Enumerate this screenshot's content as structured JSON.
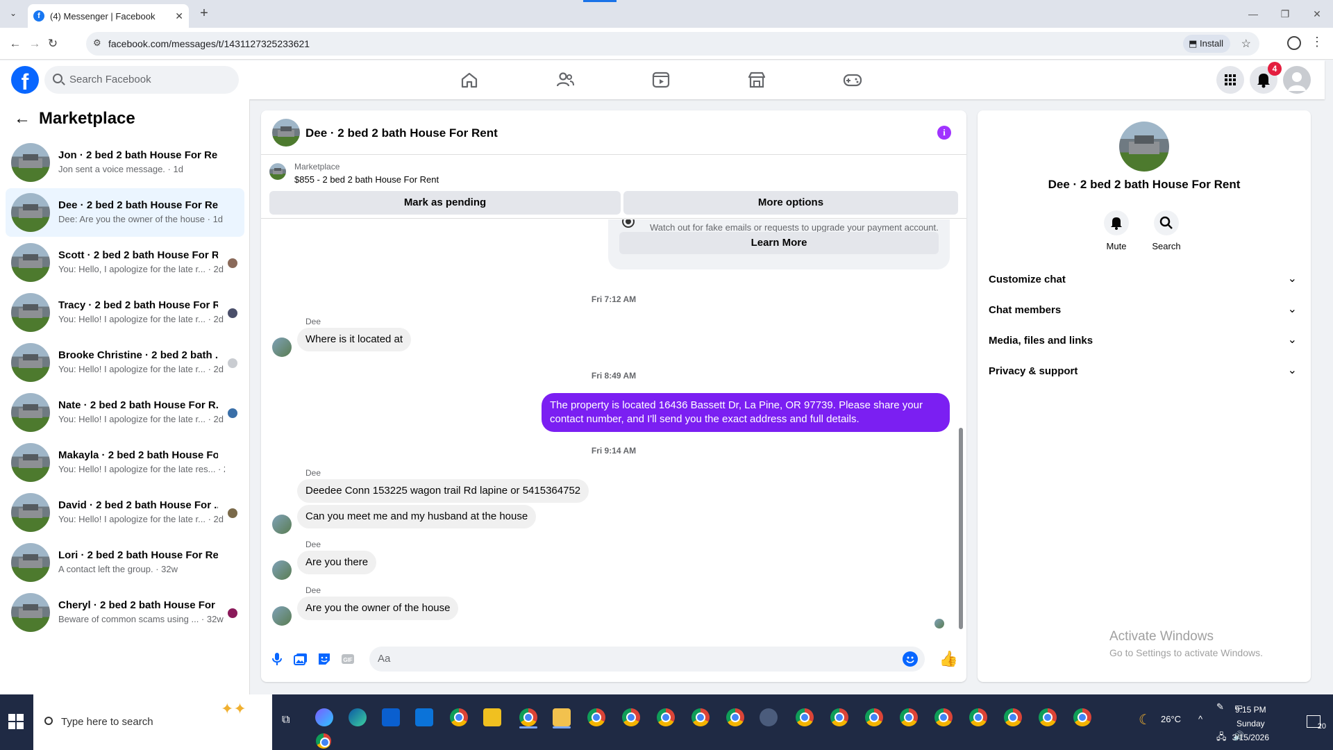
{
  "browser": {
    "tab_title": "(4) Messenger | Facebook",
    "url": "facebook.com/messages/t/1431127325233621",
    "install_label": "Install"
  },
  "fb": {
    "logo": "f",
    "search_placeholder": "Search Facebook",
    "nav_icons": [
      "home-icon",
      "friends-icon",
      "video-icon",
      "marketplace-icon",
      "gaming-icon"
    ],
    "notification_count": "4",
    "accent_color": "#0866ff"
  },
  "sidebar": {
    "title": "Marketplace",
    "conversations": [
      {
        "name": "Jon · 2 bed 2 bath House For Rent",
        "preview": "Jon sent a voice message. · 1d"
      },
      {
        "name": "Dee · 2 bed 2 bath House For Rent",
        "preview": "Dee: Are you the owner of the house · 1d"
      },
      {
        "name": "Scott · 2 bed 2 bath House For R...",
        "preview": "You: Hello, I apologize for the late r... · 2d"
      },
      {
        "name": "Tracy · 2 bed 2 bath House For R...",
        "preview": "You: Hello! I apologize for the late r... · 2d"
      },
      {
        "name": "Brooke Christine · 2 bed 2 bath ...",
        "preview": "You: Hello! I apologize for the late r... · 2d"
      },
      {
        "name": "Nate · 2 bed 2 bath House For R...",
        "preview": "You: Hello! I apologize for the late r... · 2d"
      },
      {
        "name": "Makayla · 2 bed 2 bath House For ...",
        "preview": "You: Hello! I apologize for the late res... · 2d"
      },
      {
        "name": "David · 2 bed 2 bath House For ...",
        "preview": "You: Hello! I apologize for the late r... · 2d"
      },
      {
        "name": "Lori · 2 bed 2 bath House For Rent",
        "preview": "A contact left the group. · 32w"
      },
      {
        "name": "Cheryl · 2 bed 2 bath House For ...",
        "preview": "Beware of common scams using ... · 32w"
      }
    ]
  },
  "chat": {
    "title": "Dee · 2 bed 2 bath House For Rent",
    "listing_category": "Marketplace",
    "listing_price": "$855 - 2 bed 2 bath House For Rent",
    "mark_pending": "Mark as pending",
    "more_options": "More options",
    "scam_warning": "Watch out for fake emails or requests to upgrade your payment account.",
    "learn_more": "Learn More",
    "messages": {
      "ts1": "Fri 7:12 AM",
      "sender": "Dee",
      "m1": "Where is it located at",
      "ts2": "Fri 8:49 AM",
      "m2": "The property is located 16436 Bassett Dr, La Pine, OR 97739. Please share your contact number, and I'll send you the exact address and full details.",
      "ts3": "Fri 9:14 AM",
      "m3": "Deedee Conn 153225 wagon trail Rd lapine or 5415364752",
      "m4": "Can you meet me and my husband at the house",
      "m5": "Are you there",
      "m6": "Are you the owner of the house"
    },
    "composer_placeholder": "Aa",
    "outgoing_color": "#7b1ff2"
  },
  "details": {
    "title": "Dee · 2 bed 2 bath House For Rent",
    "mute": "Mute",
    "search": "Search",
    "sections": [
      "Customize chat",
      "Chat members",
      "Media, files and links",
      "Privacy & support"
    ]
  },
  "windows": {
    "activate_title": "Activate Windows",
    "activate_sub": "Go to Settings to activate Windows."
  },
  "taskbar": {
    "search_placeholder": "Type here to search",
    "weather": "26°C",
    "time": "9:15 PM",
    "day": "Sunday",
    "date": "3/15/2026",
    "notif_count": "20"
  }
}
